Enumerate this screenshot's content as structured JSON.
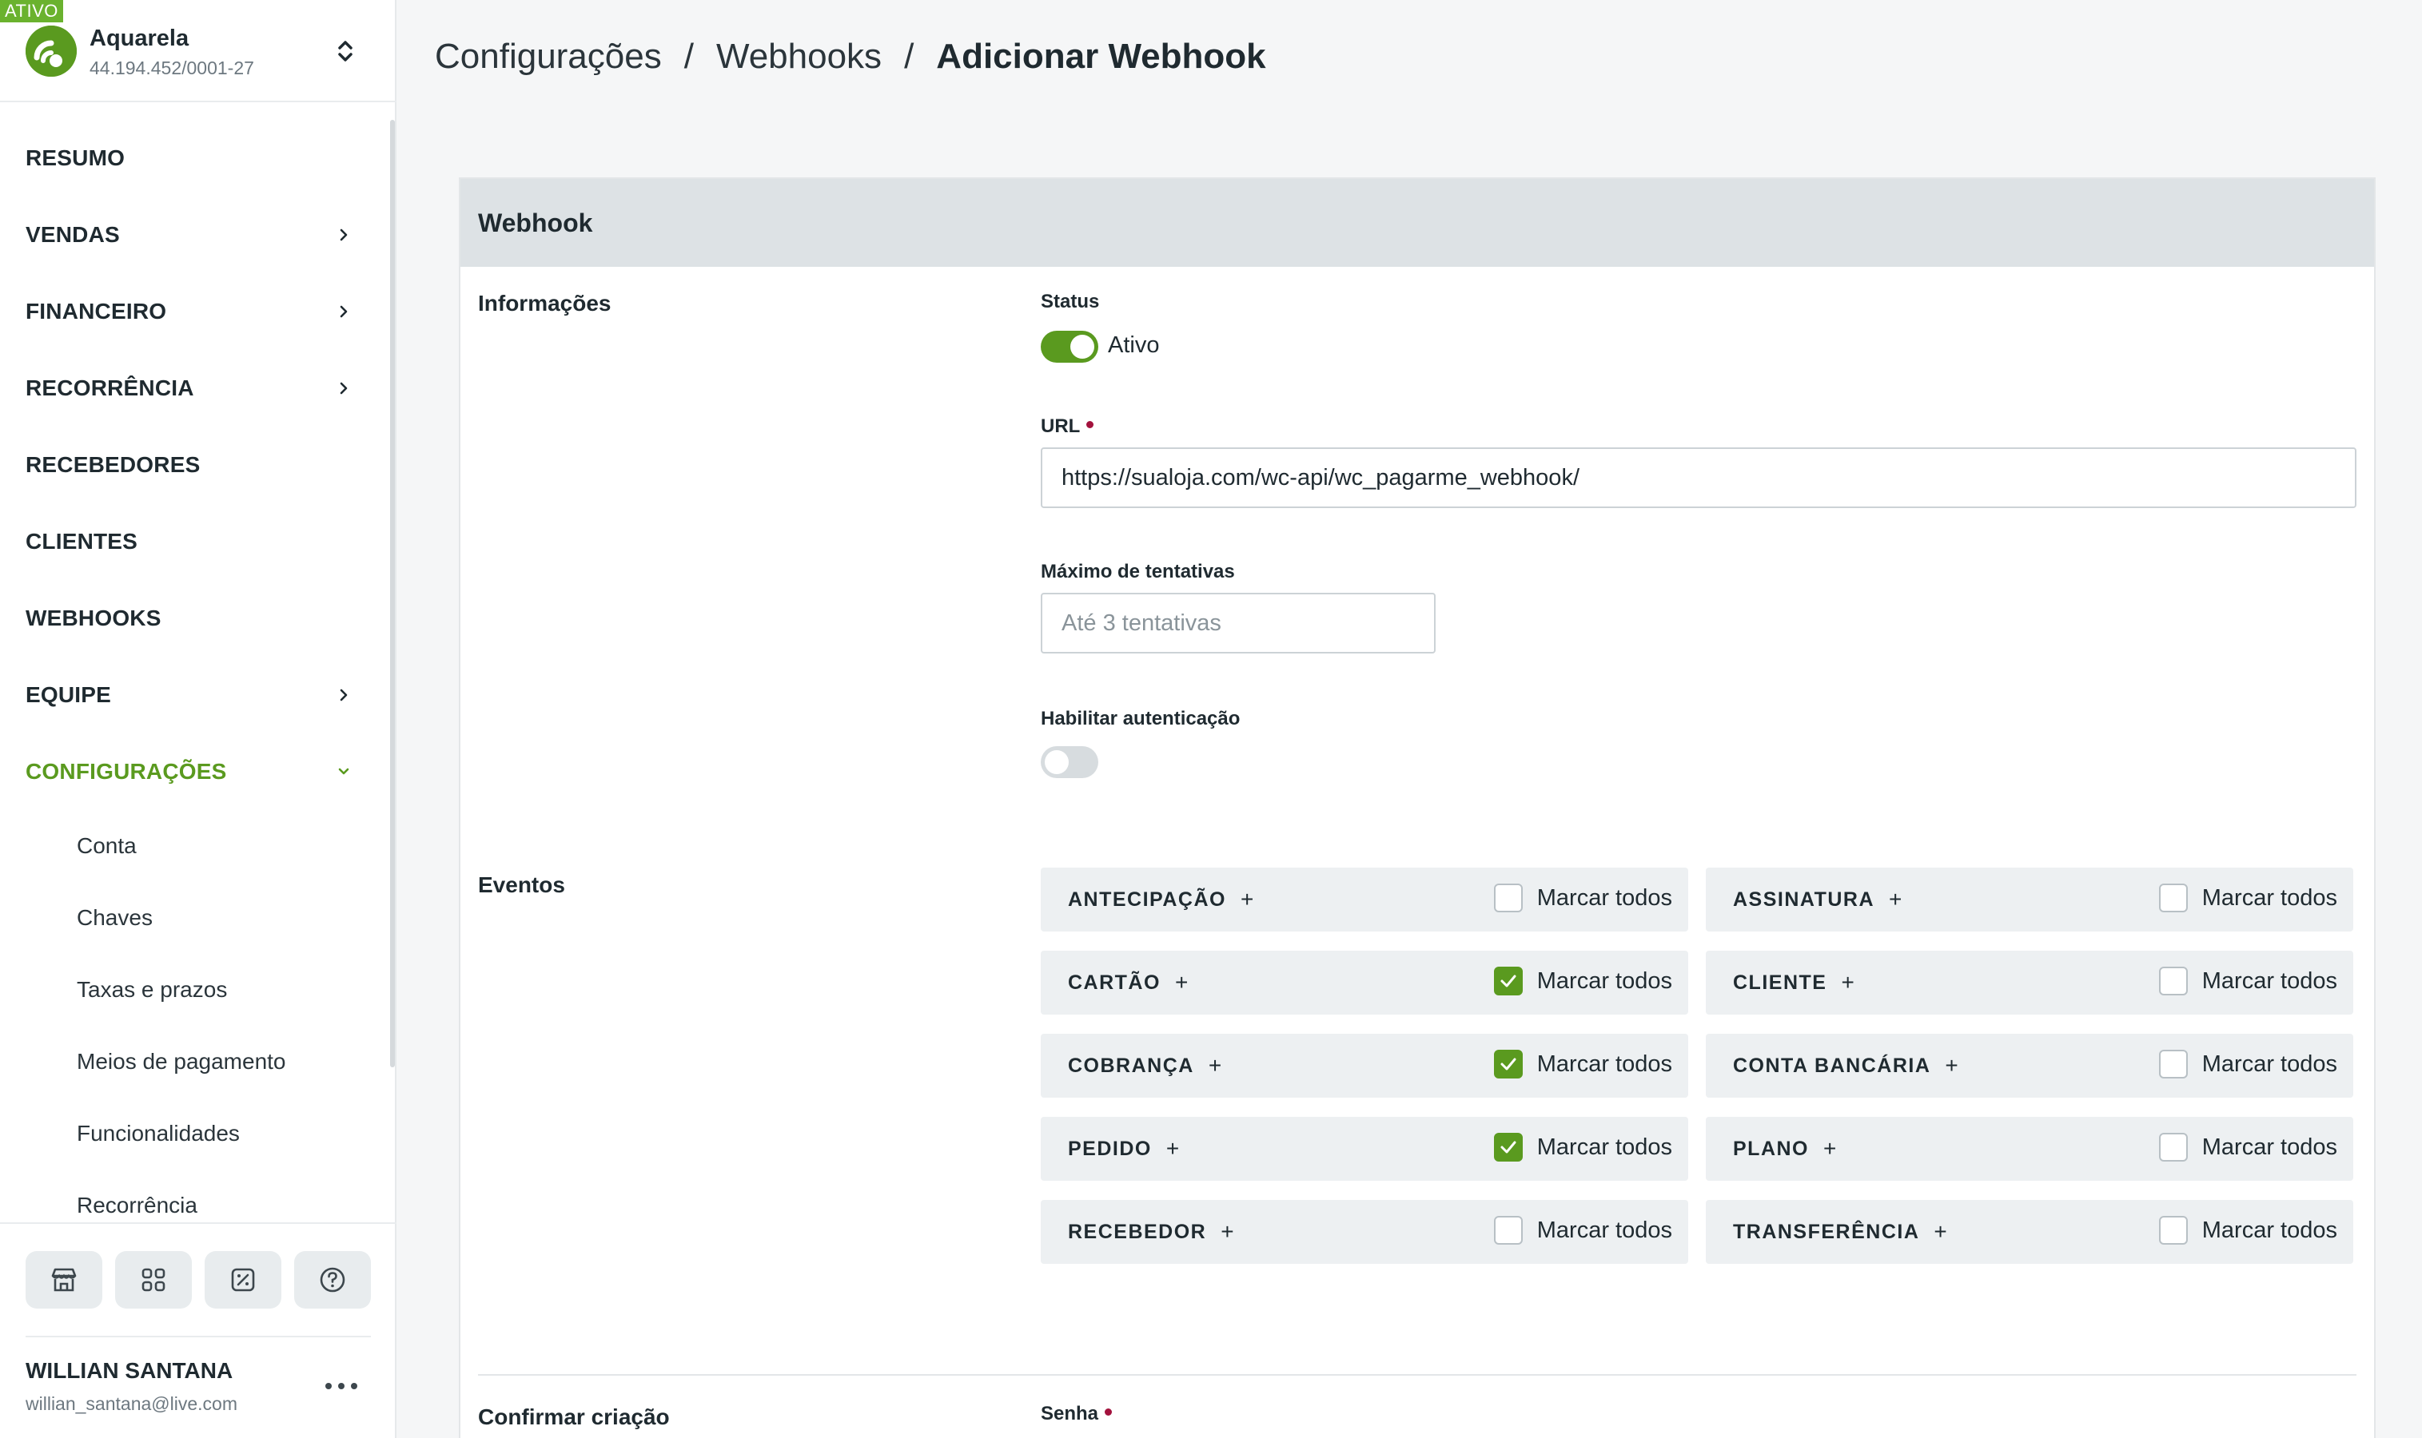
{
  "account": {
    "status_tag": "ATIVO",
    "name": "Aquarela",
    "document": "44.194.452/0001-27"
  },
  "nav": [
    {
      "label": "RESUMO",
      "chevron": ""
    },
    {
      "label": "VENDAS",
      "chevron": "right"
    },
    {
      "label": "FINANCEIRO",
      "chevron": "right"
    },
    {
      "label": "RECORRÊNCIA",
      "chevron": "right"
    },
    {
      "label": "RECEBEDORES",
      "chevron": ""
    },
    {
      "label": "CLIENTES",
      "chevron": ""
    },
    {
      "label": "WEBHOOKS",
      "chevron": ""
    },
    {
      "label": "EQUIPE",
      "chevron": "right"
    },
    {
      "label": "CONFIGURAÇÕES",
      "chevron": "down",
      "active": true
    }
  ],
  "subnav": [
    "Conta",
    "Chaves",
    "Taxas e prazos",
    "Meios de pagamento",
    "Funcionalidades",
    "Recorrência"
  ],
  "quick_actions": [
    "store-icon",
    "apps-grid-icon",
    "percent-icon",
    "help-icon"
  ],
  "user": {
    "name": "WILLIAN SANTANA",
    "email": "willian_santana@live.com"
  },
  "breadcrumb": {
    "items": [
      "Configurações",
      "Webhooks"
    ],
    "separator": "/",
    "current": "Adicionar Webhook"
  },
  "form": {
    "card_title": "Webhook",
    "info_section": "Informações",
    "status_label": "Status",
    "status_value": "Ativo",
    "status_on": true,
    "url_label": "URL",
    "url_value": "https://sualoja.com/wc-api/wc_pagarme_webhook/",
    "max_attempts_label": "Máximo de tentativas",
    "max_attempts_placeholder": "Até 3 tentativas",
    "auth_label": "Habilitar autenticação",
    "auth_on": false,
    "events_section": "Eventos",
    "mark_all_label": "Marcar todos",
    "confirm_section": "Confirmar criação",
    "password_label": "Senha"
  },
  "events": [
    {
      "name": "ANTECIPAÇÃO",
      "checked": false
    },
    {
      "name": "ASSINATURA",
      "checked": false
    },
    {
      "name": "CARTÃO",
      "checked": true
    },
    {
      "name": "CLIENTE",
      "checked": false
    },
    {
      "name": "COBRANÇA",
      "checked": true
    },
    {
      "name": "CONTA BANCÁRIA",
      "checked": false
    },
    {
      "name": "PEDIDO",
      "checked": true
    },
    {
      "name": "PLANO",
      "checked": false
    },
    {
      "name": "RECEBEDOR",
      "checked": false
    },
    {
      "name": "TRANSFERÊNCIA",
      "checked": false
    }
  ],
  "colors": {
    "accent": "#5a9a1f",
    "status_tag": "#6ab22e",
    "required": "#a3123d"
  }
}
